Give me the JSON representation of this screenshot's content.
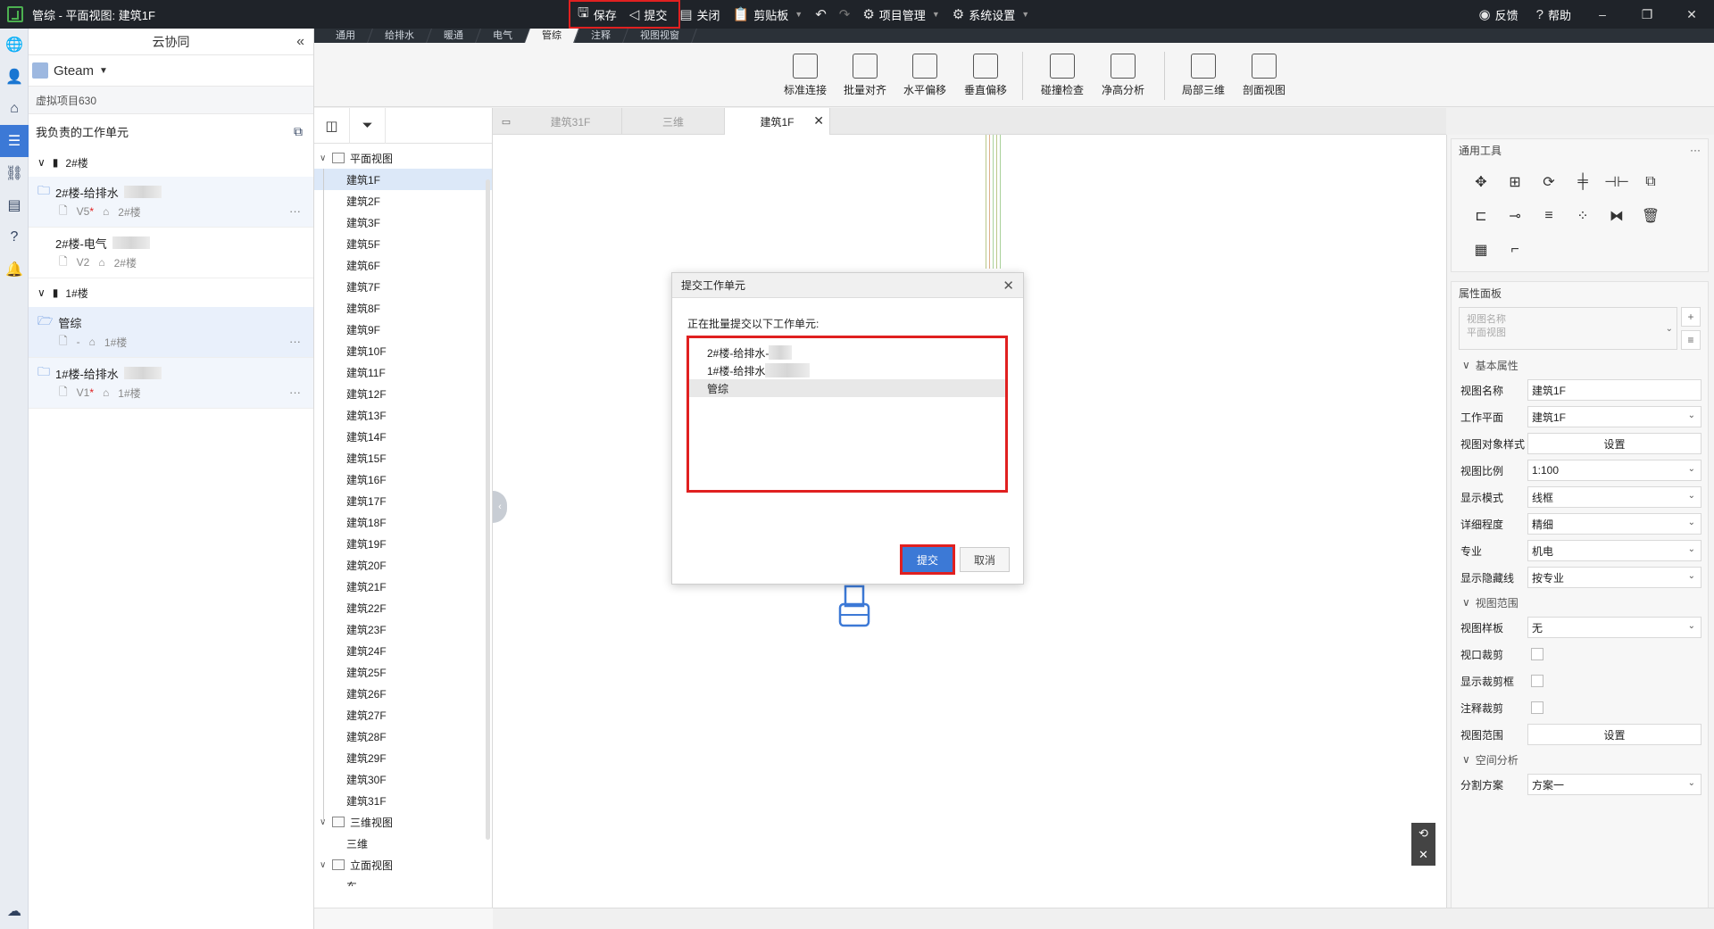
{
  "window": {
    "title": "管综 - 平面视图: 建筑1F"
  },
  "toolbar": {
    "save": "保存",
    "submit": "提交",
    "close": "关闭",
    "clipboard": "剪贴板",
    "project_mgmt": "项目管理",
    "settings": "系统设置",
    "feedback": "反馈",
    "help": "帮助"
  },
  "cloud": {
    "title": "云协同",
    "team": "Gteam",
    "project": "虚拟项目630",
    "my_units": "我负责的工作单元",
    "groups": [
      {
        "name": "2#楼",
        "units": [
          {
            "name": "2#楼-给排水",
            "version": "V5",
            "building": "2#楼",
            "modified": true
          },
          {
            "name": "2#楼-电气",
            "version": "V2",
            "building": "2#楼",
            "modified": false
          }
        ]
      },
      {
        "name": "1#楼",
        "units": [
          {
            "name": "管综",
            "version": "-",
            "building": "1#楼",
            "modified": false
          },
          {
            "name": "1#楼-给排水",
            "version": "V1",
            "building": "1#楼",
            "modified": true
          }
        ]
      }
    ]
  },
  "ribbon": {
    "tabs": [
      "通用",
      "给排水",
      "暖通",
      "电气",
      "管综",
      "注释",
      "视图视窗"
    ],
    "active_tab": "管综",
    "buttons": [
      "标准连接",
      "批量对齐",
      "水平偏移",
      "垂直偏移",
      "碰撞检查",
      "净高分析",
      "局部三维",
      "剖面视图"
    ]
  },
  "browser": {
    "plan_views": "平面视图",
    "floors": [
      "建筑1F",
      "建筑2F",
      "建筑3F",
      "建筑5F",
      "建筑6F",
      "建筑7F",
      "建筑8F",
      "建筑9F",
      "建筑10F",
      "建筑11F",
      "建筑12F",
      "建筑13F",
      "建筑14F",
      "建筑15F",
      "建筑16F",
      "建筑17F",
      "建筑18F",
      "建筑19F",
      "建筑20F",
      "建筑21F",
      "建筑22F",
      "建筑23F",
      "建筑24F",
      "建筑25F",
      "建筑26F",
      "建筑27F",
      "建筑28F",
      "建筑29F",
      "建筑30F",
      "建筑31F"
    ],
    "views_3d": "三维视图",
    "view_3d_item": "三维",
    "elevations": "立面视图",
    "elevation_item": "东"
  },
  "view_tabs": [
    "建筑31F",
    "三维",
    "建筑1F"
  ],
  "right": {
    "tools_title": "通用工具",
    "props_title": "属性面板",
    "type_line1": "视图名称",
    "type_line2": "平面视图",
    "basic": "基本属性",
    "props": [
      {
        "label": "视图名称",
        "value": "建筑1F",
        "kind": "text"
      },
      {
        "label": "工作平面",
        "value": "建筑1F",
        "kind": "select"
      },
      {
        "label": "视图对象样式",
        "value": "设置",
        "kind": "button"
      },
      {
        "label": "视图比例",
        "value": "1:100",
        "kind": "select"
      },
      {
        "label": "显示模式",
        "value": "线框",
        "kind": "select"
      },
      {
        "label": "详细程度",
        "value": "精细",
        "kind": "select"
      },
      {
        "label": "专业",
        "value": "机电",
        "kind": "select"
      },
      {
        "label": "显示隐藏线",
        "value": "按专业",
        "kind": "select"
      }
    ],
    "range": "视图范围",
    "range_props": [
      {
        "label": "视图样板",
        "value": "无",
        "kind": "select"
      },
      {
        "label": "视口裁剪",
        "value": "",
        "kind": "check"
      },
      {
        "label": "显示裁剪框",
        "value": "",
        "kind": "check"
      },
      {
        "label": "注释裁剪",
        "value": "",
        "kind": "check"
      },
      {
        "label": "视图范围",
        "value": "设置",
        "kind": "button"
      }
    ],
    "spatial": "空间分析",
    "split_label": "分割方案",
    "split_value": "方案一"
  },
  "dialog": {
    "title": "提交工作单元",
    "message": "正在批量提交以下工作单元:",
    "items": [
      "2#楼-给排水-",
      "1#楼-给排水",
      "管综"
    ],
    "submit": "提交",
    "cancel": "取消"
  },
  "colors": {
    "accent": "#3c79d6",
    "highlight": "#e02020",
    "titlebar": "#1f2329"
  }
}
